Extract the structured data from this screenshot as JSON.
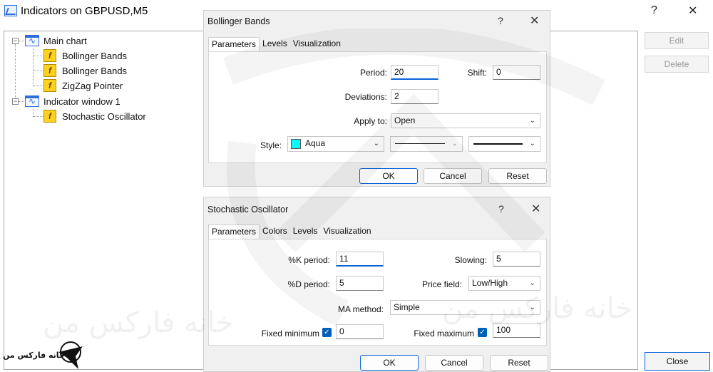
{
  "main_window": {
    "title": "Indicators on GBPUSD,M5",
    "help": "?",
    "close": "✕",
    "tree": [
      {
        "label": "Main chart",
        "kind": "window"
      },
      {
        "label": "Bollinger Bands",
        "kind": "indicator"
      },
      {
        "label": "Bollinger Bands",
        "kind": "indicator"
      },
      {
        "label": "ZigZag Pointer",
        "kind": "indicator"
      },
      {
        "label": "Indicator window 1",
        "kind": "window"
      },
      {
        "label": "Stochastic Oscillator",
        "kind": "indicator"
      }
    ],
    "buttons": {
      "edit": "Edit",
      "delete": "Delete",
      "close": "Close"
    }
  },
  "bollinger_dialog": {
    "title": "Bollinger Bands",
    "help": "?",
    "close": "✕",
    "tabs": [
      "Parameters",
      "Levels",
      "Visualization"
    ],
    "fields": {
      "period_label": "Period:",
      "period_value": "20",
      "shift_label": "Shift:",
      "shift_value": "0",
      "deviations_label": "Deviations:",
      "deviations_value": "2",
      "apply_to_label": "Apply to:",
      "apply_to_value": "Open",
      "style_label": "Style:",
      "style_color": "Aqua"
    },
    "buttons": {
      "ok": "OK",
      "cancel": "Cancel",
      "reset": "Reset"
    }
  },
  "stochastic_dialog": {
    "title": "Stochastic Oscillator",
    "help": "?",
    "close": "✕",
    "tabs": [
      "Parameters",
      "Colors",
      "Levels",
      "Visualization"
    ],
    "fields": {
      "k_period_label": "%K period:",
      "k_period_value": "11",
      "slowing_label": "Slowing:",
      "slowing_value": "5",
      "d_period_label": "%D period:",
      "d_period_value": "5",
      "price_field_label": "Price field:",
      "price_field_value": "Low/High",
      "ma_method_label": "MA method:",
      "ma_method_value": "Simple",
      "fixed_min_label": "Fixed minimum",
      "fixed_min_value": "0",
      "fixed_max_label": "Fixed maximum",
      "fixed_max_value": "100"
    },
    "buttons": {
      "ok": "OK",
      "cancel": "Cancel",
      "reset": "Reset"
    }
  },
  "watermark": {
    "text": "خانه فارکس من",
    "logo_text": "خانه فارکس من"
  },
  "colors": {
    "accent": "#0a64d8",
    "aqua": "#00ffff",
    "indicator_icon": "#ffd21f"
  }
}
